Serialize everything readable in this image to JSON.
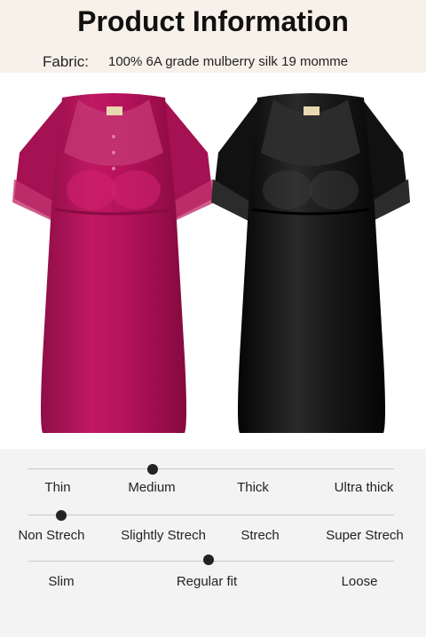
{
  "header": {
    "title": "Product Information",
    "fabric_label": "Fabric:",
    "fabric_value": "100% 6A grade mulberry silk 19 momme"
  },
  "product_images": [
    {
      "color": "#b0135a"
    },
    {
      "color": "#141414"
    }
  ],
  "specs": {
    "thickness": {
      "options": [
        "Thin",
        "Medium",
        "Thick",
        "Ultra thick"
      ],
      "selected": "Medium"
    },
    "stretch": {
      "options": [
        "Non Strech",
        "Slightly Strech",
        "Strech",
        "Super Strech"
      ],
      "selected": "Non Strech"
    },
    "fit": {
      "options": [
        "Slim",
        "Regular fit",
        "Loose"
      ],
      "selected": "Regular fit"
    }
  }
}
